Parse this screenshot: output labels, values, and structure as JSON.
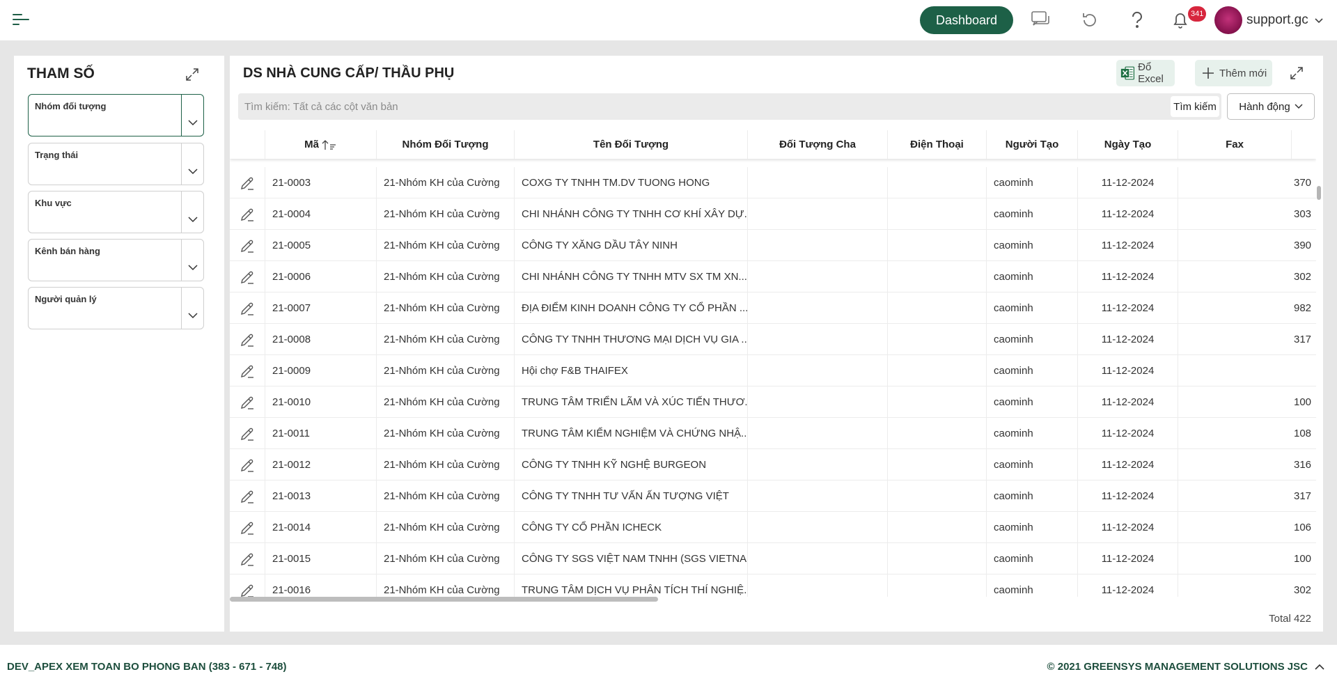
{
  "header": {
    "dashboard_label": "Dashboard",
    "notification_count": "341",
    "username": "support.gc"
  },
  "params": {
    "title": "THAM SỐ",
    "filters": [
      {
        "label": "Nhóm đối tượng"
      },
      {
        "label": "Trạng thái"
      },
      {
        "label": "Khu vực"
      },
      {
        "label": "Kênh bán hàng"
      },
      {
        "label": "Người quản lý"
      }
    ]
  },
  "main": {
    "title": "DS NHÀ CUNG CẤP/ THẦU PHỤ",
    "export_excel_label": "Đổ Excel",
    "add_new_label": "Thêm mới",
    "search_placeholder": "Tìm kiếm: Tất cả các cột văn bản",
    "search_button_label": "Tìm kiếm",
    "action_button_label": "Hành động",
    "total_label": "Total 422"
  },
  "table": {
    "columns": [
      "Mã",
      "Nhóm Đối Tượng",
      "Tên Đối Tượng",
      "Đối Tượng Cha",
      "Điện Thoại",
      "Người Tạo",
      "Ngày Tạo",
      "Fax"
    ],
    "rows": [
      {
        "ma": "21-0003",
        "nhom": "21-Nhóm KH của Cường",
        "ten": "COXG TY TNHH TM.DV TUONG HONG",
        "cha": "",
        "dt": "",
        "nguoi_tao": "caominh",
        "ngay_tao": "11-12-2024",
        "fax": "370"
      },
      {
        "ma": "21-0004",
        "nhom": "21-Nhóm KH của Cường",
        "ten": "CHI NHÁNH CÔNG TY TNHH CƠ KHÍ XÂY DỰ...",
        "cha": "",
        "dt": "",
        "nguoi_tao": "caominh",
        "ngay_tao": "11-12-2024",
        "fax": "303"
      },
      {
        "ma": "21-0005",
        "nhom": "21-Nhóm KH của Cường",
        "ten": "CÔNG TY XĂNG DẦU TÂY NINH",
        "cha": "",
        "dt": "",
        "nguoi_tao": "caominh",
        "ngay_tao": "11-12-2024",
        "fax": "390"
      },
      {
        "ma": "21-0006",
        "nhom": "21-Nhóm KH của Cường",
        "ten": "CHI NHÁNH CÔNG TY TNHH MTV SX TM XN...",
        "cha": "",
        "dt": "",
        "nguoi_tao": "caominh",
        "ngay_tao": "11-12-2024",
        "fax": "302"
      },
      {
        "ma": "21-0007",
        "nhom": "21-Nhóm KH của Cường",
        "ten": "ĐỊA ĐIỂM KINH DOANH CÔNG TY CỔ PHẦN ...",
        "cha": "",
        "dt": "",
        "nguoi_tao": "caominh",
        "ngay_tao": "11-12-2024",
        "fax": "982"
      },
      {
        "ma": "21-0008",
        "nhom": "21-Nhóm KH của Cường",
        "ten": "CÔNG TY TNHH THƯƠNG MẠI DỊCH VỤ GIA ...",
        "cha": "",
        "dt": "",
        "nguoi_tao": "caominh",
        "ngay_tao": "11-12-2024",
        "fax": "317"
      },
      {
        "ma": "21-0009",
        "nhom": "21-Nhóm KH của Cường",
        "ten": "Hội chợ F&B THAIFEX",
        "cha": "",
        "dt": "",
        "nguoi_tao": "caominh",
        "ngay_tao": "11-12-2024",
        "fax": ""
      },
      {
        "ma": "21-0010",
        "nhom": "21-Nhóm KH của Cường",
        "ten": "TRUNG TÂM TRIỂN LÃM VÀ XÚC TIẾN THƯƠ...",
        "cha": "",
        "dt": "",
        "nguoi_tao": "caominh",
        "ngay_tao": "11-12-2024",
        "fax": "100"
      },
      {
        "ma": "21-0011",
        "nhom": "21-Nhóm KH của Cường",
        "ten": "TRUNG TÂM KIỂM NGHIỆM VÀ CHỨNG NHẬ...",
        "cha": "",
        "dt": "",
        "nguoi_tao": "caominh",
        "ngay_tao": "11-12-2024",
        "fax": "108"
      },
      {
        "ma": "21-0012",
        "nhom": "21-Nhóm KH của Cường",
        "ten": "CÔNG TY TNHH KỸ NGHỆ BURGEON",
        "cha": "",
        "dt": "",
        "nguoi_tao": "caominh",
        "ngay_tao": "11-12-2024",
        "fax": "316"
      },
      {
        "ma": "21-0013",
        "nhom": "21-Nhóm KH của Cường",
        "ten": "CÔNG TY TNHH TƯ VẤN ẤN TƯỢNG VIỆT",
        "cha": "",
        "dt": "",
        "nguoi_tao": "caominh",
        "ngay_tao": "11-12-2024",
        "fax": "317"
      },
      {
        "ma": "21-0014",
        "nhom": "21-Nhóm KH của Cường",
        "ten": "CÔNG TY CỔ PHẦN ICHECK",
        "cha": "",
        "dt": "",
        "nguoi_tao": "caominh",
        "ngay_tao": "11-12-2024",
        "fax": "106"
      },
      {
        "ma": "21-0015",
        "nhom": "21-Nhóm KH của Cường",
        "ten": "CÔNG TY SGS VIỆT NAM TNHH (SGS VIETNA...",
        "cha": "",
        "dt": "",
        "nguoi_tao": "caominh",
        "ngay_tao": "11-12-2024",
        "fax": "100"
      },
      {
        "ma": "21-0016",
        "nhom": "21-Nhóm KH của Cường",
        "ten": "TRUNG TÂM DỊCH VỤ PHÂN TÍCH THÍ NGHIỆ...",
        "cha": "",
        "dt": "",
        "nguoi_tao": "caominh",
        "ngay_tao": "11-12-2024",
        "fax": "302"
      }
    ]
  },
  "footer": {
    "left_text": "DEV_APEX XEM TOAN BO PHONG BAN (383 - 671 - 748)",
    "right_text": "© 2021 GREENSYS MANAGEMENT SOLUTIONS JSC"
  },
  "colors": {
    "brand_green": "#1d6047",
    "badge_red": "#d7263d",
    "page_bg": "#e6e6e6"
  }
}
